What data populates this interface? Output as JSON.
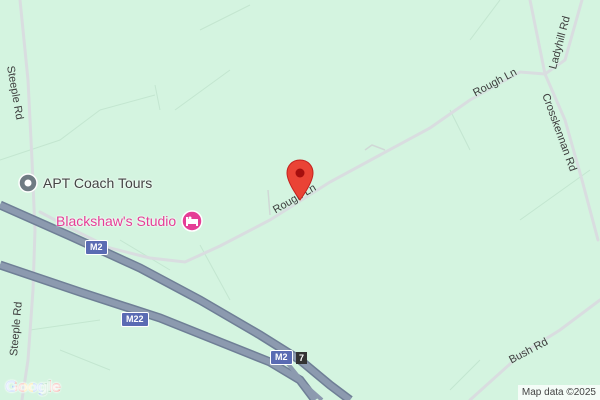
{
  "colors": {
    "land": "#d4f4e0",
    "minor_road": "#ffffff",
    "local_road": "#d9dde0",
    "motorway": "#8c9aaf",
    "motorway_casing": "#6f7f96",
    "pin": "#ea4335",
    "poi_gray": "#444444",
    "hotel_pink": "#e53e96"
  },
  "roads": {
    "rough_ln_1": "Rough Ln",
    "rough_ln_2": "Rough Ln",
    "steeple_rd_top": "Steeple Rd",
    "steeple_rd_bottom": "Steeple Rd",
    "ladyhill_rd": "Ladyhill Rd",
    "crosskennan_rd": "Crosskennan Rd",
    "bush_rd": "Bush Rd"
  },
  "shields": {
    "m2_upper": "M2",
    "m22": "M22",
    "m2_lower": "M2",
    "junction": "7"
  },
  "pois": {
    "apt": {
      "name": "APT Coach Tours",
      "icon": "pin-circle-icon"
    },
    "studio": {
      "name": "Blackshaw's Studio",
      "icon": "hotel-bed-icon"
    }
  },
  "marker": {
    "icon": "red-map-pin-icon"
  },
  "branding": {
    "logo": "Google",
    "attribution": "Map data ©2025"
  }
}
